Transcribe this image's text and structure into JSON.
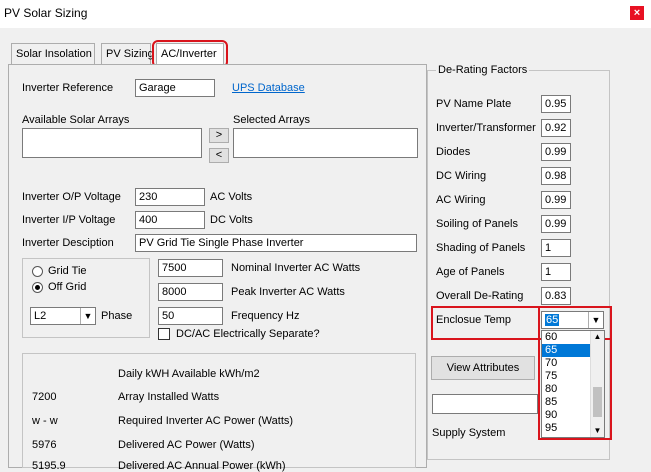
{
  "window": {
    "title": "PV Solar Sizing",
    "close": "×"
  },
  "tabs": [
    {
      "label": "Solar Insolation"
    },
    {
      "label": "PV Sizing"
    },
    {
      "label": "AC/Inverter"
    }
  ],
  "inverter": {
    "reference_label": "Inverter Reference",
    "reference_value": "Garage",
    "ups_link": "UPS Database",
    "available_arrays_label": "Available Solar Arrays",
    "selected_arrays_label": "Selected Arrays",
    "move_right": ">",
    "move_left": "<",
    "op_voltage_label": "Inverter O/P Voltage",
    "op_voltage_value": "230",
    "op_voltage_unit": "AC Volts",
    "ip_voltage_label": "Inverter I/P Voltage",
    "ip_voltage_value": "400",
    "ip_voltage_unit": "DC Volts",
    "description_label": "Inverter Desciption",
    "description_value": "PV Grid Tie Single Phase Inverter",
    "grid_tie_label": "Grid Tie",
    "off_grid_label": "Off Grid",
    "phase_value": "L2",
    "phase_label": "Phase",
    "nominal_watts_value": "7500",
    "nominal_watts_label": "Nominal Inverter AC Watts",
    "peak_watts_value": "8000",
    "peak_watts_label": "Peak Inverter AC Watts",
    "frequency_value": "50",
    "frequency_label": "Frequency Hz",
    "separate_label": "DC/AC Electrically Separate?"
  },
  "results": {
    "header": "Daily kWH Available kWh/m2",
    "rows": [
      {
        "value": "7200",
        "label": "Array Installed Watts"
      },
      {
        "value": "w - w",
        "label": "Required Inverter AC Power (Watts)"
      },
      {
        "value": "5976",
        "label": "Delivered AC Power (Watts)"
      },
      {
        "value": "5195.9",
        "label": "Delivered AC Annual Power (kWh)"
      }
    ]
  },
  "derating": {
    "title": "De-Rating Factors",
    "items": [
      {
        "label": "PV Name Plate",
        "value": "0.95"
      },
      {
        "label": "Inverter/Transformer",
        "value": "0.92"
      },
      {
        "label": "Diodes",
        "value": "0.99"
      },
      {
        "label": "DC Wiring",
        "value": "0.98"
      },
      {
        "label": "AC Wiring",
        "value": "0.99"
      },
      {
        "label": "Soiling of Panels",
        "value": "0.99"
      },
      {
        "label": "Shading of Panels",
        "value": "1"
      },
      {
        "label": "Age of Panels",
        "value": "1"
      },
      {
        "label": "Overall De-Rating",
        "value": "0.83"
      }
    ],
    "enclosure_label": "Enclosue Temp",
    "enclosure_value": "65",
    "dropdown_options": [
      "60",
      "65",
      "70",
      "75",
      "80",
      "85",
      "90",
      "95"
    ],
    "selected_option": "65"
  },
  "view_attributes": "View Attributes",
  "supply_system_label": "Supply System",
  "colors": {
    "highlight": "#d9141c",
    "selection": "#0078d7",
    "link": "#0066cc"
  }
}
